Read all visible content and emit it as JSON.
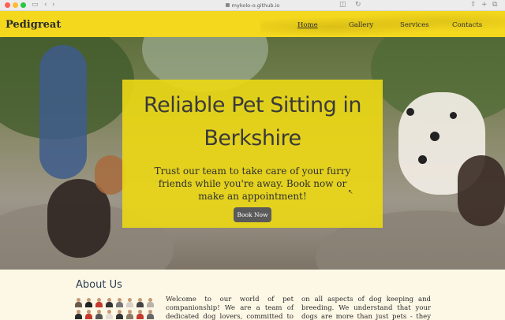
{
  "browser": {
    "url": "mykolo-o.github.io",
    "icons": [
      "sidebar-icon",
      "back-icon",
      "forward-icon",
      "lock-icon",
      "reload-icon",
      "share-icon",
      "new-tab-icon",
      "tabs-icon"
    ]
  },
  "nav": {
    "brand": "Pedigreat",
    "links": [
      {
        "label": "Home",
        "active": true
      },
      {
        "label": "Gallery",
        "active": false
      },
      {
        "label": "Services",
        "active": false
      },
      {
        "label": "Contacts",
        "active": false
      }
    ]
  },
  "hero": {
    "title_line1": "Reliable Pet Sitting in",
    "title_line2": "Berkshire",
    "text": "Trust our team to take care of your furry friends while you're away. Book now or make an appointment!",
    "button": "Book Now"
  },
  "about": {
    "title": "About Us",
    "col1": "Welcome to our world of pet companionship! We are a team of dedicated dog lovers, committed to",
    "col2": "on all aspects of dog keeping and breeding. We understand that your dogs are more than just pets - they are part of your family."
  },
  "colors": {
    "accent": "#f3d81e",
    "hero_card": "#ecd814",
    "button": "#5a5a5a",
    "about_bg": "#fdf8e6"
  }
}
